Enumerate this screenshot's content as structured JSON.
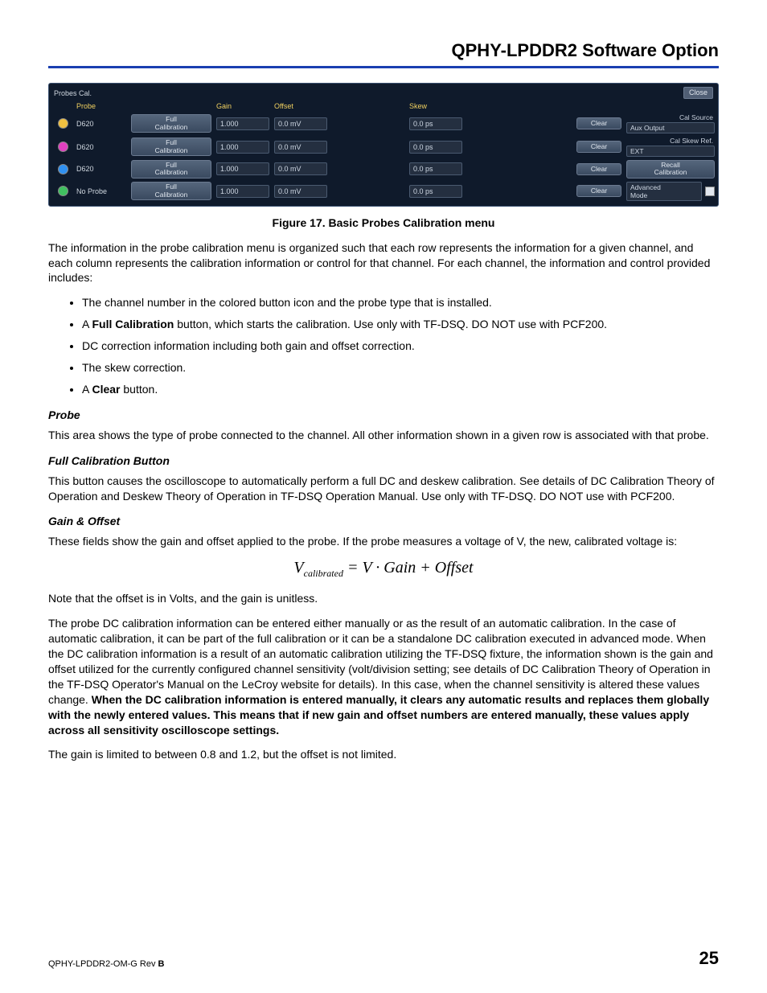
{
  "header": {
    "title": "QPHY-LPDDR2 Software Option"
  },
  "figure": {
    "panel_title": "Probes Cal.",
    "close": "Close",
    "headers": {
      "probe": "Probe",
      "gain": "Gain",
      "offset": "Offset",
      "skew": "Skew"
    },
    "full_cal": "Full\nCalibration",
    "clear": "Clear",
    "rows": [
      {
        "color": "#f0c040",
        "probe": "D620",
        "gain": "1.000",
        "offset": "0.0 mV",
        "skew": "0.0 ps"
      },
      {
        "color": "#e040c0",
        "probe": "D620",
        "gain": "1.000",
        "offset": "0.0 mV",
        "skew": "0.0 ps"
      },
      {
        "color": "#3090f0",
        "probe": "D620",
        "gain": "1.000",
        "offset": "0.0 mV",
        "skew": "0.0 ps"
      },
      {
        "color": "#40c060",
        "probe": "No Probe",
        "gain": "1.000",
        "offset": "0.0 mV",
        "skew": "0.0 ps"
      }
    ],
    "side": {
      "cal_source_lbl": "Cal Source",
      "cal_source_val": "Aux Output",
      "cal_skew_lbl": "Cal Skew Ref.",
      "cal_skew_val": "EXT",
      "recall": "Recall\nCalibration",
      "adv_lbl": "Advanced\nMode"
    },
    "caption": "Figure 17. Basic Probes Calibration menu"
  },
  "para1": "The information in the probe calibration menu is organized such that each row represents the information for a given channel, and each column represents the calibration information or control for that channel. For each channel, the information and control provided includes:",
  "bullets": {
    "b1": "The channel number in the colored button icon and the probe type that is installed.",
    "b2a": "A ",
    "b2b": "Full Calibration",
    "b2c": " button, which starts the calibration. Use only with TF-DSQ. DO NOT use with PCF200.",
    "b3": "DC correction information including both gain and offset correction.",
    "b4": "The skew correction.",
    "b5a": "A ",
    "b5b": "Clear",
    "b5c": " button."
  },
  "sections": {
    "probe_h": "Probe",
    "probe_p": "This area shows the type of probe connected to the channel. All other information shown in a given row is associated with that probe.",
    "fcb_h": "Full Calibration Button",
    "fcb_p": "This button causes the oscilloscope to automatically perform a full DC and deskew calibration. See details of DC Calibration Theory of Operation and Deskew Theory of Operation in TF-DSQ Operation Manual. Use only with TF-DSQ. DO NOT use with PCF200.",
    "go_h": "Gain & Offset",
    "go_p1": "These fields show the gain and offset applied to the probe. If the probe measures a voltage of V, the new, calibrated voltage is:",
    "eq_v": "V",
    "eq_sub": "calibrated",
    "eq_eq": " = V · Gain + Offset",
    "go_p2": "Note that the offset is in Volts, and the gain is unitless.",
    "go_p3a": "The probe DC calibration information can be entered either manually or as the result of an automatic calibration. In the case of automatic calibration, it can be part of the full calibration or it can be a standalone DC calibration executed in advanced mode. When the DC calibration information is a result of an automatic calibration utilizing the TF-DSQ fixture, the information shown is the gain and offset utilized for the currently configured channel sensitivity (volt/division setting; see details of DC Calibration Theory of Operation in the TF-DSQ Operator's Manual on the LeCroy website for details). In this case, when the channel sensitivity is altered these values change. ",
    "go_p3b": "When the DC calibration information is entered manually, it clears any automatic results and replaces them globally with the newly entered values. This means that if new gain and offset numbers are entered manually, these values apply across all sensitivity oscilloscope settings.",
    "go_p4": "The gain is limited to between 0.8 and 1.2, but the offset is not limited."
  },
  "footer": {
    "doc": "QPHY-LPDDR2-OM-G Rev ",
    "rev": "B",
    "page": "25"
  }
}
